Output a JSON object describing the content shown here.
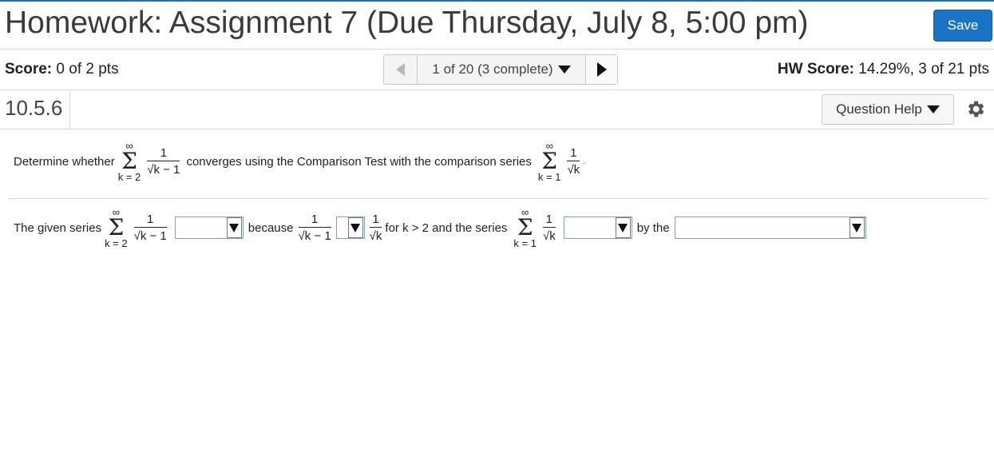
{
  "header": {
    "title": "Homework: Assignment 7 (Due Thursday, July 8, 5:00 pm)",
    "save_label": "Save"
  },
  "status": {
    "score_label": "Score:",
    "score_value": "0 of 2 pts",
    "nav_label": "1 of 20 (3 complete)",
    "hw_score_label": "HW Score:",
    "hw_score_value": "14.29%, 3 of 21 pts"
  },
  "question": {
    "number": "10.5.6",
    "help_label": "Question Help"
  },
  "problem": {
    "text_1": "Determine whether",
    "sum_upper": "∞",
    "sum_lower_k2": "k = 2",
    "sum_lower_k1": "k = 1",
    "one": "1",
    "den_sqrt_minus": "√k − 1",
    "den_sqrt": "√k",
    "text_2": "converges using the Comparison Test with the comparison series",
    "period": "."
  },
  "answer": {
    "text_1": "The given series",
    "text_2": "because",
    "text_3": "for k > 2 and the series",
    "text_4": "by the",
    "dropdown_1_value": "",
    "dropdown_2_value": "",
    "dropdown_3_value": "",
    "dropdown_4_value": ""
  },
  "icons": {
    "prev": "chevron-left-icon",
    "next": "chevron-right-icon",
    "help_caret": "caret-down-icon",
    "settings": "gear-icon"
  }
}
